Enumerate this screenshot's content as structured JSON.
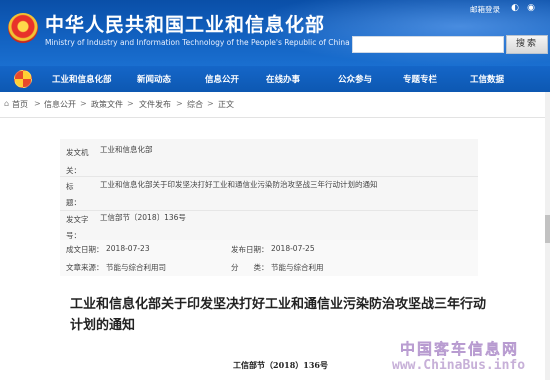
{
  "header": {
    "site_title": "中华人民共和国工业和信息化部",
    "site_subtitle": "Ministry of Industry and Information Technology of the People's Republic of China",
    "mail_login": "邮箱登录",
    "search_placeholder": "",
    "search_label": "搜索",
    "emblem_icon": "national-emblem-icon"
  },
  "nav": {
    "items": [
      {
        "label": "工业和信息化部"
      },
      {
        "label": "新闻动态"
      },
      {
        "label": "信息公开"
      },
      {
        "label": "在线办事"
      },
      {
        "label": "公众参与"
      },
      {
        "label": "专题专栏"
      },
      {
        "label": "工信数据"
      }
    ]
  },
  "breadcrumb": {
    "items": [
      "首页",
      "信息公开",
      "政策文件",
      "文件发布",
      "综合",
      "正文"
    ],
    "separator": ">"
  },
  "meta": {
    "issuer_label": "发文机关：",
    "issuer_value": "工业和信息化部",
    "title_label": "标　　题：",
    "title_value": "工业和信息化部关于印发坚决打好工业和通信业污染防治攻坚战三年行动计划的通知",
    "docno_label": "发文字号：",
    "docno_value": "工信部节〔2018〕136号",
    "created_label": "成文日期：",
    "created_value": "2018-07-23",
    "published_label": "发布日期：",
    "published_value": "2018-07-25",
    "source_label": "文章来源：",
    "source_value": "节能与综合利用司",
    "category_label": "分　　类：",
    "category_value": "节能与综合利用"
  },
  "article": {
    "title": "工业和信息化部关于印发坚决打好工业和通信业污染防治攻坚战三年行动计划的通知",
    "doc_number": "工信部节（2018）136号"
  },
  "watermark": {
    "cn": "中国客车信息网",
    "en": "www.ChinaBus.info"
  },
  "colors": {
    "header_blue": "#0a4fa8",
    "nav_blue": "#1566c8",
    "text": "#333333"
  }
}
